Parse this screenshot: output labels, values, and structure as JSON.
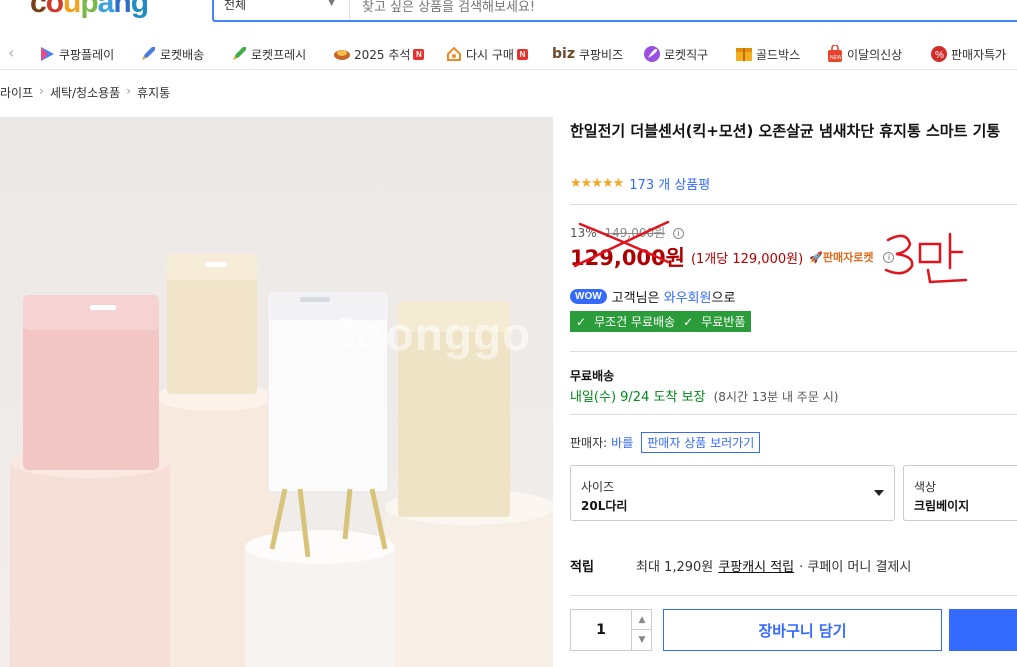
{
  "header": {
    "logo_text": "coupang",
    "search_category": "전체",
    "search_placeholder": "찾고 싶은 상품을 검색해보세요!"
  },
  "nav": {
    "items": [
      {
        "label": "쿠팡플레이",
        "icon": "play-icon"
      },
      {
        "label": "로켓배송",
        "icon": "rocket-icon"
      },
      {
        "label": "로켓프레시",
        "icon": "rocket-fresh-icon"
      },
      {
        "label": "2025 추석",
        "icon": "gift-icon",
        "badge": "N"
      },
      {
        "label": "다시 구매",
        "icon": "repurchase-icon",
        "badge": "N"
      },
      {
        "label": "쿠팡비즈",
        "icon": "biz-icon",
        "prefix": "biz"
      },
      {
        "label": "로켓직구",
        "icon": "global-rocket-icon"
      },
      {
        "label": "골드박스",
        "icon": "gold-box-icon"
      },
      {
        "label": "이달의신상",
        "icon": "new-bag-icon"
      },
      {
        "label": "판매자특가",
        "icon": "seller-deal-icon"
      }
    ]
  },
  "breadcrumb": [
    "라이프",
    "세탁/청소용품",
    "휴지통"
  ],
  "product": {
    "title": "한일전기 더블센서(킥+모션) 오존살균 냄새차단 휴지통 스마트 기통",
    "rating_stars": 4.5,
    "review_count": "173 개 상품평",
    "discount_rate": "13%",
    "original_price": "149,000원",
    "price": "129,000원",
    "unit_price": "(1개당 129,000원)",
    "seller_rocket": "판매자로켓",
    "wow_badge": "WOW",
    "wow_text_1": "고객님은",
    "wow_link": "와우회원",
    "wow_text_2": "으로",
    "free_shipping": "무조건 무료배송",
    "free_return": "무료반품",
    "shipping_label": "무료배송",
    "delivery_date": "내일(수) 9/24 도착 보장",
    "delivery_note": "(8시간 13분 내 주문 시)",
    "seller_label": "판매자:",
    "seller_name": "바를",
    "seller_button": "판매자 상품 보러가기",
    "watermark": "Joonggo"
  },
  "options": [
    {
      "label": "사이즈",
      "value": "20L다리"
    },
    {
      "label": "색상",
      "value": "크림베이지"
    }
  ],
  "points": {
    "label": "적립",
    "text_1": "최대 1,290원",
    "link": "쿠팡캐시 적립",
    "text_2": "· 쿠페이 머니 결제시"
  },
  "purchase": {
    "quantity": "1",
    "cart_button": "장바구니 담기"
  },
  "annotation": {
    "handwritten_text": "3만",
    "color": "#e0141c"
  },
  "colors": {
    "accent": "#346aff",
    "price": "#ae0000",
    "green": "#2b9c3a"
  }
}
